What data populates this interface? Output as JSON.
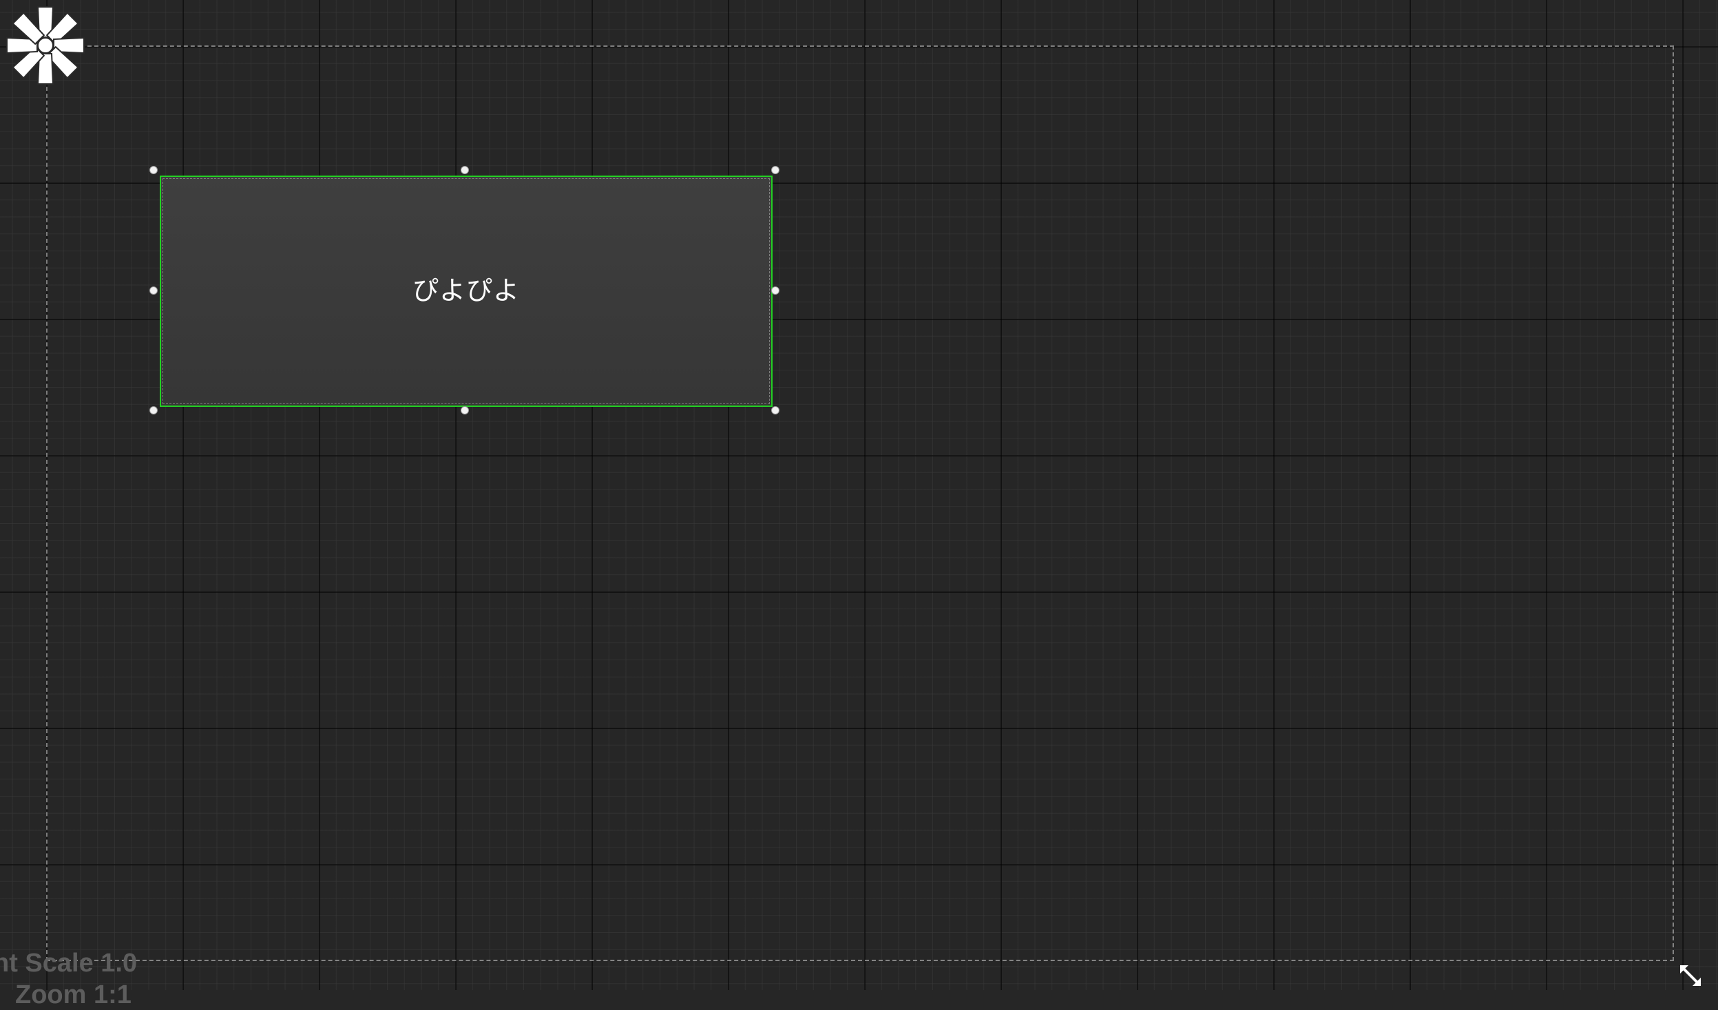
{
  "designer": {
    "widget": {
      "label": "ぴよぴよ",
      "selection_color": "#23d023"
    },
    "status": {
      "dpi_scale_text": "nt Scale 1.0",
      "zoom_text": "Zoom 1:1"
    },
    "icons": {
      "anchor": "anchor-flower-icon",
      "resize": "resize-arrows-icon"
    },
    "colors": {
      "background": "#262626",
      "widget_fill": "#3c3c3c",
      "text": "#ffffff",
      "status_text": "#5d5d5d"
    }
  }
}
